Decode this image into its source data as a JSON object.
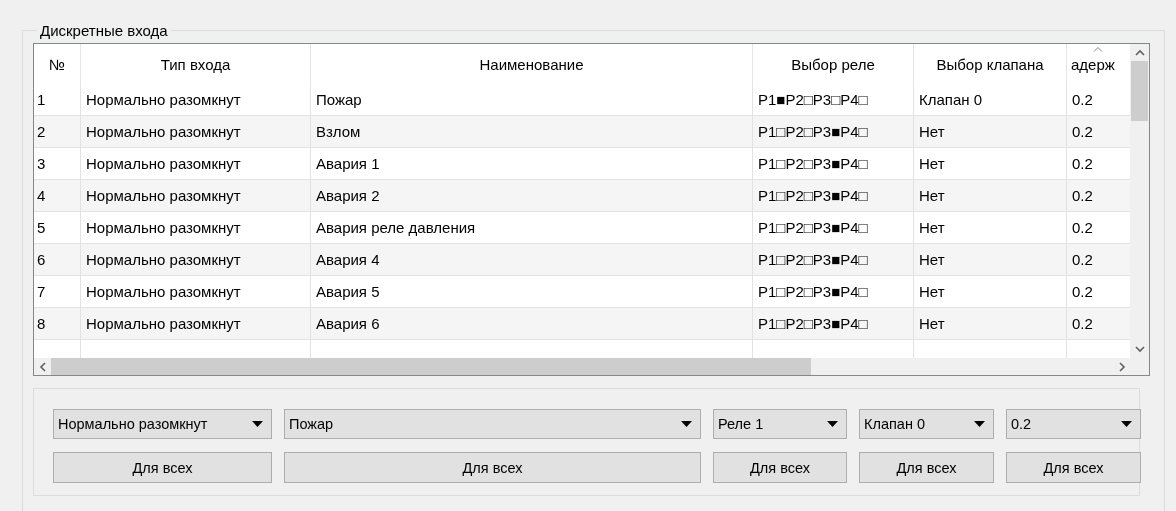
{
  "group": {
    "title": "Дискретные входа"
  },
  "table": {
    "columns": [
      {
        "label": "№",
        "sorted": false
      },
      {
        "label": "Тип входа",
        "sorted": false
      },
      {
        "label": "Наименование",
        "sorted": false
      },
      {
        "label": "Выбор реле",
        "sorted": false
      },
      {
        "label": "Выбор клапана",
        "sorted": false
      },
      {
        "label": "адерж",
        "sorted": true
      }
    ],
    "rows": [
      {
        "cells": [
          "1",
          "Нормально разомкнут",
          "Пожар",
          "P1■P2□P3□P4□",
          "Клапан 0",
          "0.2"
        ]
      },
      {
        "cells": [
          "2",
          "Нормально разомкнут",
          "Взлом",
          "P1□P2□P3■P4□",
          "Нет",
          "0.2"
        ]
      },
      {
        "cells": [
          "3",
          "Нормально разомкнут",
          "Авария 1",
          "P1□P2□P3■P4□",
          "Нет",
          "0.2"
        ]
      },
      {
        "cells": [
          "4",
          "Нормально разомкнут",
          "Авария 2",
          "P1□P2□P3■P4□",
          "Нет",
          "0.2"
        ]
      },
      {
        "cells": [
          "5",
          "Нормально разомкнут",
          "Авария реле давления",
          "P1□P2□P3■P4□",
          "Нет",
          "0.2"
        ]
      },
      {
        "cells": [
          "6",
          "Нормально разомкнут",
          "Авария 4",
          "P1□P2□P3■P4□",
          "Нет",
          "0.2"
        ]
      },
      {
        "cells": [
          "7",
          "Нормально разомкнут",
          "Авария 5",
          "P1□P2□P3■P4□",
          "Нет",
          "0.2"
        ]
      },
      {
        "cells": [
          "8",
          "Нормально разомкнут",
          "Авария 6",
          "P1□P2□P3■P4□",
          "Нет",
          "0.2"
        ]
      }
    ]
  },
  "controls": [
    {
      "value": "Нормально разомкнут",
      "button": "Для всех"
    },
    {
      "value": "Пожар",
      "button": "Для всех"
    },
    {
      "value": "Реле 1",
      "button": "Для всех"
    },
    {
      "value": "Клапан 0",
      "button": "Для всех"
    },
    {
      "value": "0.2",
      "button": "Для всех"
    }
  ]
}
